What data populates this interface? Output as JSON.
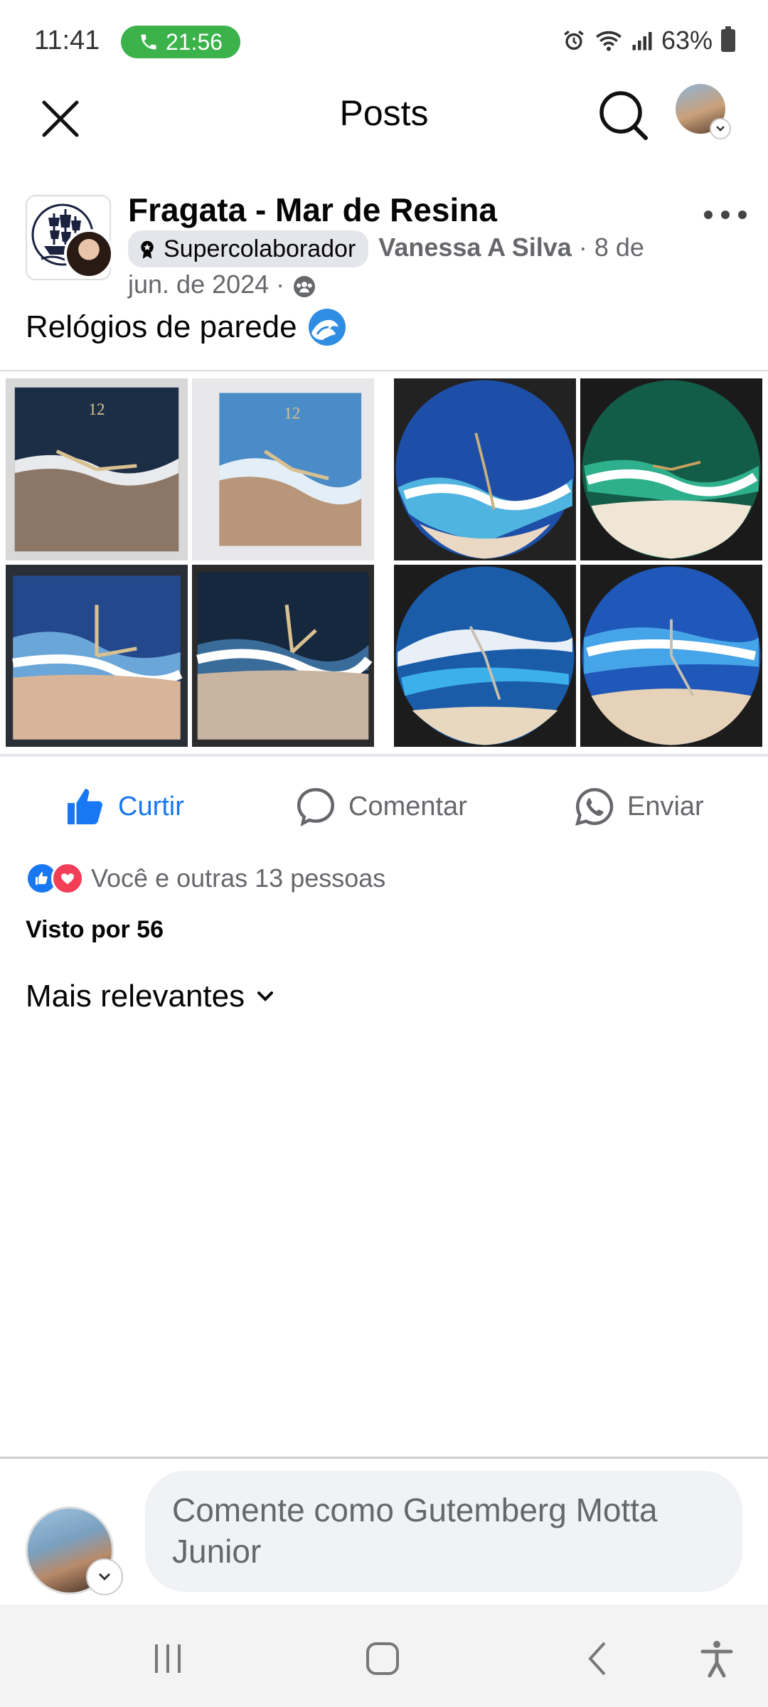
{
  "status_bar": {
    "time": "11:41",
    "call_duration": "21:56",
    "battery": "63%"
  },
  "header": {
    "title": "Posts"
  },
  "post": {
    "group_name": "Fragata - Mar de Resina",
    "badge": "Supercolaborador",
    "author": "Vanessa A Silva",
    "date": "· 8 de jun. de 2024 ·",
    "text": "Relógios de parede",
    "photos": [
      {
        "shape": "square",
        "water": "#1c2e45"
      },
      {
        "shape": "square",
        "water": "#4a8cc8"
      },
      {
        "shape": "round",
        "water": "#1e4fa8"
      },
      {
        "shape": "round",
        "water": "#1c7a5c"
      },
      {
        "shape": "square",
        "water": "#24488c"
      },
      {
        "shape": "square",
        "water": "#15283e"
      },
      {
        "shape": "round",
        "water": "#1a5ca8"
      },
      {
        "shape": "round",
        "water": "#1f58b8"
      }
    ]
  },
  "actions": {
    "like": "Curtir",
    "comment": "Comentar",
    "send": "Enviar"
  },
  "reactions": {
    "summary": "Você e outras 13 pessoas",
    "views": "Visto por 56"
  },
  "comments": {
    "sort": "Mais relevantes",
    "placeholder": "Comente como Gutemberg Motta Junior"
  },
  "colors": {
    "accent": "#1877f2",
    "call_green": "#3bb34a",
    "love": "#f33e58"
  }
}
